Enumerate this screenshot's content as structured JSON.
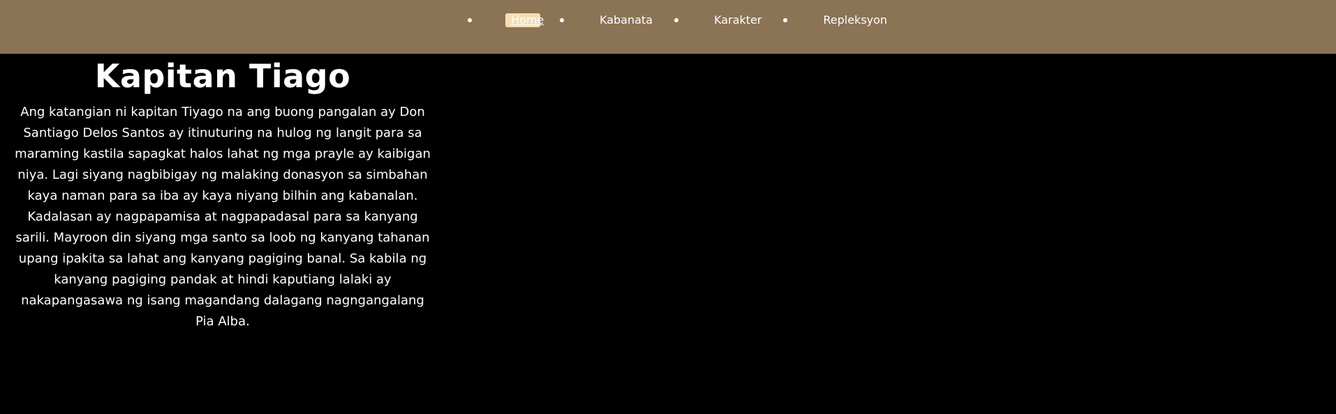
{
  "nav": {
    "items": [
      {
        "label": "Home",
        "active": true
      },
      {
        "label": "Kabanata",
        "active": false
      },
      {
        "label": "Karakter",
        "active": false
      },
      {
        "label": "Repleksyon",
        "active": false
      }
    ]
  },
  "main": {
    "title": "Kapitan Tiago",
    "body": "Ang katangian ni kapitan Tiyago na ang buong pangalan ay Don Santiago Delos Santos ay itinuturing na hulog ng langit para sa maraming kastila sapagkat halos lahat ng mga prayle ay kaibigan niya. Lagi siyang nagbibigay ng malaking donasyon sa simbahan kaya naman para sa iba ay kaya niyang bilhin ang kabanalan. Kadalasan ay nagpapamisa at nagpapadasal para sa kanyang sarili. Mayroon din siyang mga santo sa loob ng kanyang tahanan upang ipakita sa lahat ang kanyang pagiging banal. Sa kabila ng kanyang pagiging pandak at hindi kaputiang lalaki ay nakapangasawa ng isang magandang dalagang nagngangalang Pia Alba."
  },
  "colors": {
    "navbar_bg": "#8b7355",
    "page_bg": "#000000",
    "active_highlight": "#f5deb3",
    "text": "#ffffff"
  }
}
